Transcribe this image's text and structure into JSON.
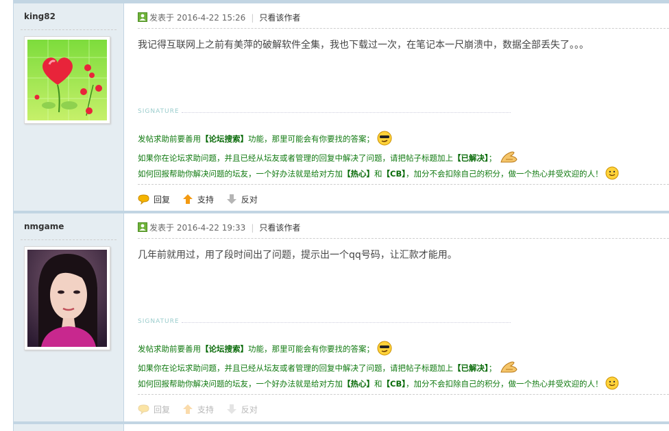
{
  "posts": [
    {
      "author": "king82",
      "posted_label": "发表于 2016-4-22 15:26",
      "only_author": "只看该作者",
      "message": "我记得互联网上之前有美萍的破解软件全集，我也下载过一次，在笔记本一尺崩溃中，数据全部丢失了。。。",
      "actions": {
        "reply": "回复",
        "support": "支持",
        "oppose": "反对"
      }
    },
    {
      "author": "nmgame",
      "posted_label": "发表于 2016-4-22 19:33",
      "only_author": "只看该作者",
      "message": "几年前就用过，用了段时间出了问题，提示出一个qq号码，让汇款才能用。",
      "actions": {
        "reply": "回复",
        "support": "支持",
        "oppose": "反对"
      }
    }
  ],
  "signature": {
    "label": "SIGNATURE",
    "line1": {
      "pre": "发帖求助前要善用",
      "bold": "【论坛搜索】",
      "post": "功能，那里可能会有你要找的答案；"
    },
    "line2": {
      "pre": "如果你在论坛求助问题，并且已经从坛友或者管理的回复中解决了问题，请把帖子标题加上",
      "bold": "【已解决】",
      "post": "；"
    },
    "line3": {
      "pre": "如何回报帮助你解决问题的坛友，一个好办法就是给对方加",
      "bold1": "【热心】",
      "mid": "和",
      "bold2": "【CB】",
      "post": "，加分不会扣除自己的积分，做一个热心并受欢迎的人！"
    }
  },
  "icons": {
    "post_icon": "post-icon",
    "reply_icon": "reply-bubble-icon",
    "support_icon": "up-arrow-icon",
    "oppose_icon": "down-arrow-icon",
    "emoticon_1": "cool-face-emoticon",
    "emoticon_2": "pointing-hand-emoticon",
    "emoticon_3": "smile-face-emoticon"
  },
  "colors": {
    "border": "#c2d5e3",
    "sidebar": "#e5edf2",
    "signature_green": "#117a11"
  }
}
